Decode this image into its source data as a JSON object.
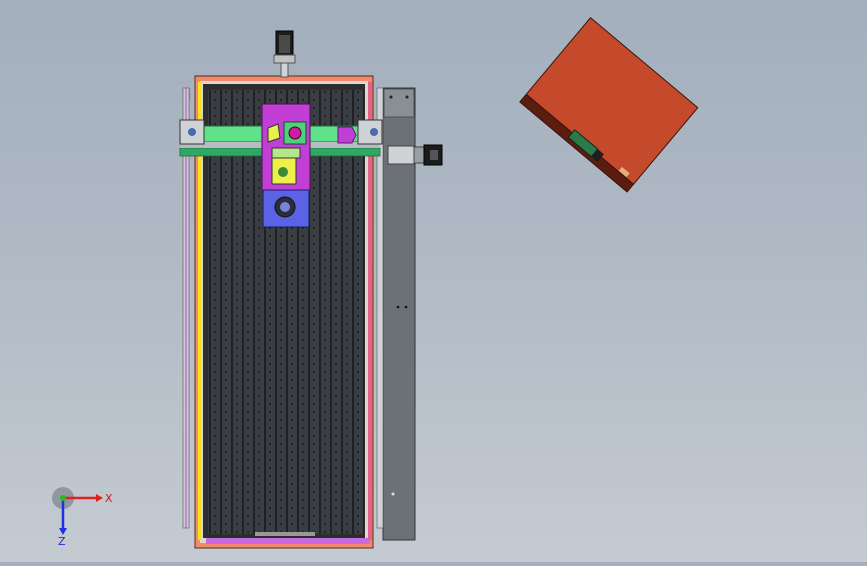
{
  "colors": {
    "background_top": "#a3afbd",
    "background_bottom": "#c5cbd2",
    "table_bed": "#3f4448",
    "frame_salmon": "#f08a6a",
    "rail_yellow": "#f4e321",
    "gantry_green": "#5fe28a",
    "carriage_magenta": "#c23fd6",
    "motor_plate_blue": "#5b63e4",
    "side_panel_gray": "#6c7077",
    "control_box_orange": "#c44a2b",
    "axis_x": "#e02020",
    "axis_y": "#20c020",
    "axis_z": "#2030e0"
  },
  "triad": {
    "x_label": "X",
    "z_label": "Z"
  }
}
